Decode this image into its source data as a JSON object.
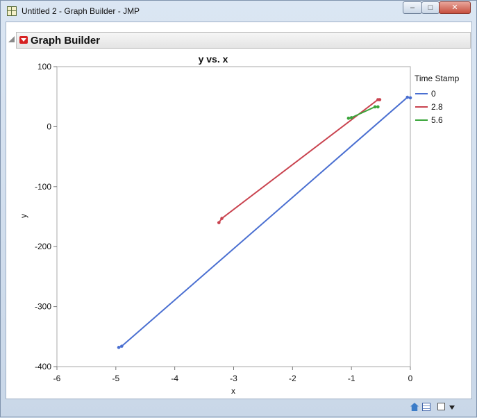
{
  "window": {
    "title": "Untitled 2 - Graph Builder - JMP",
    "minimize_glyph": "–",
    "maximize_glyph": "□",
    "close_glyph": "✕"
  },
  "report": {
    "title": "Graph Builder"
  },
  "colors": {
    "series_0": "#4a6fd1",
    "series_2_8": "#c9434f",
    "series_5_6": "#3aa53a",
    "frame": "#a8a8a8"
  },
  "chart_data": {
    "type": "line",
    "title": "y vs. x",
    "xlabel": "x",
    "ylabel": "y",
    "xlim": [
      -6,
      0
    ],
    "ylim": [
      -400,
      100
    ],
    "x_ticks": [
      "-6",
      "-5",
      "-4",
      "-3",
      "-2",
      "-1",
      "0"
    ],
    "y_ticks": [
      "100",
      "0",
      "-100",
      "-200",
      "-300",
      "-400"
    ],
    "grid": false,
    "legend_title": "Time Stamp",
    "legend_position": "right",
    "series": [
      {
        "name": "0",
        "color": "#4a6fd1",
        "points": [
          [
            -4.95,
            -368
          ],
          [
            -4.9,
            -366
          ],
          [
            -0.05,
            49
          ],
          [
            0.0,
            48
          ]
        ]
      },
      {
        "name": "2.8",
        "color": "#c9434f",
        "points": [
          [
            -3.25,
            -160
          ],
          [
            -3.2,
            -153
          ],
          [
            -0.55,
            45
          ],
          [
            -0.52,
            45
          ]
        ]
      },
      {
        "name": "5.6",
        "color": "#3aa53a",
        "points": [
          [
            -1.05,
            14
          ],
          [
            -1.0,
            15
          ],
          [
            -0.6,
            33
          ],
          [
            -0.55,
            33
          ]
        ]
      }
    ]
  }
}
